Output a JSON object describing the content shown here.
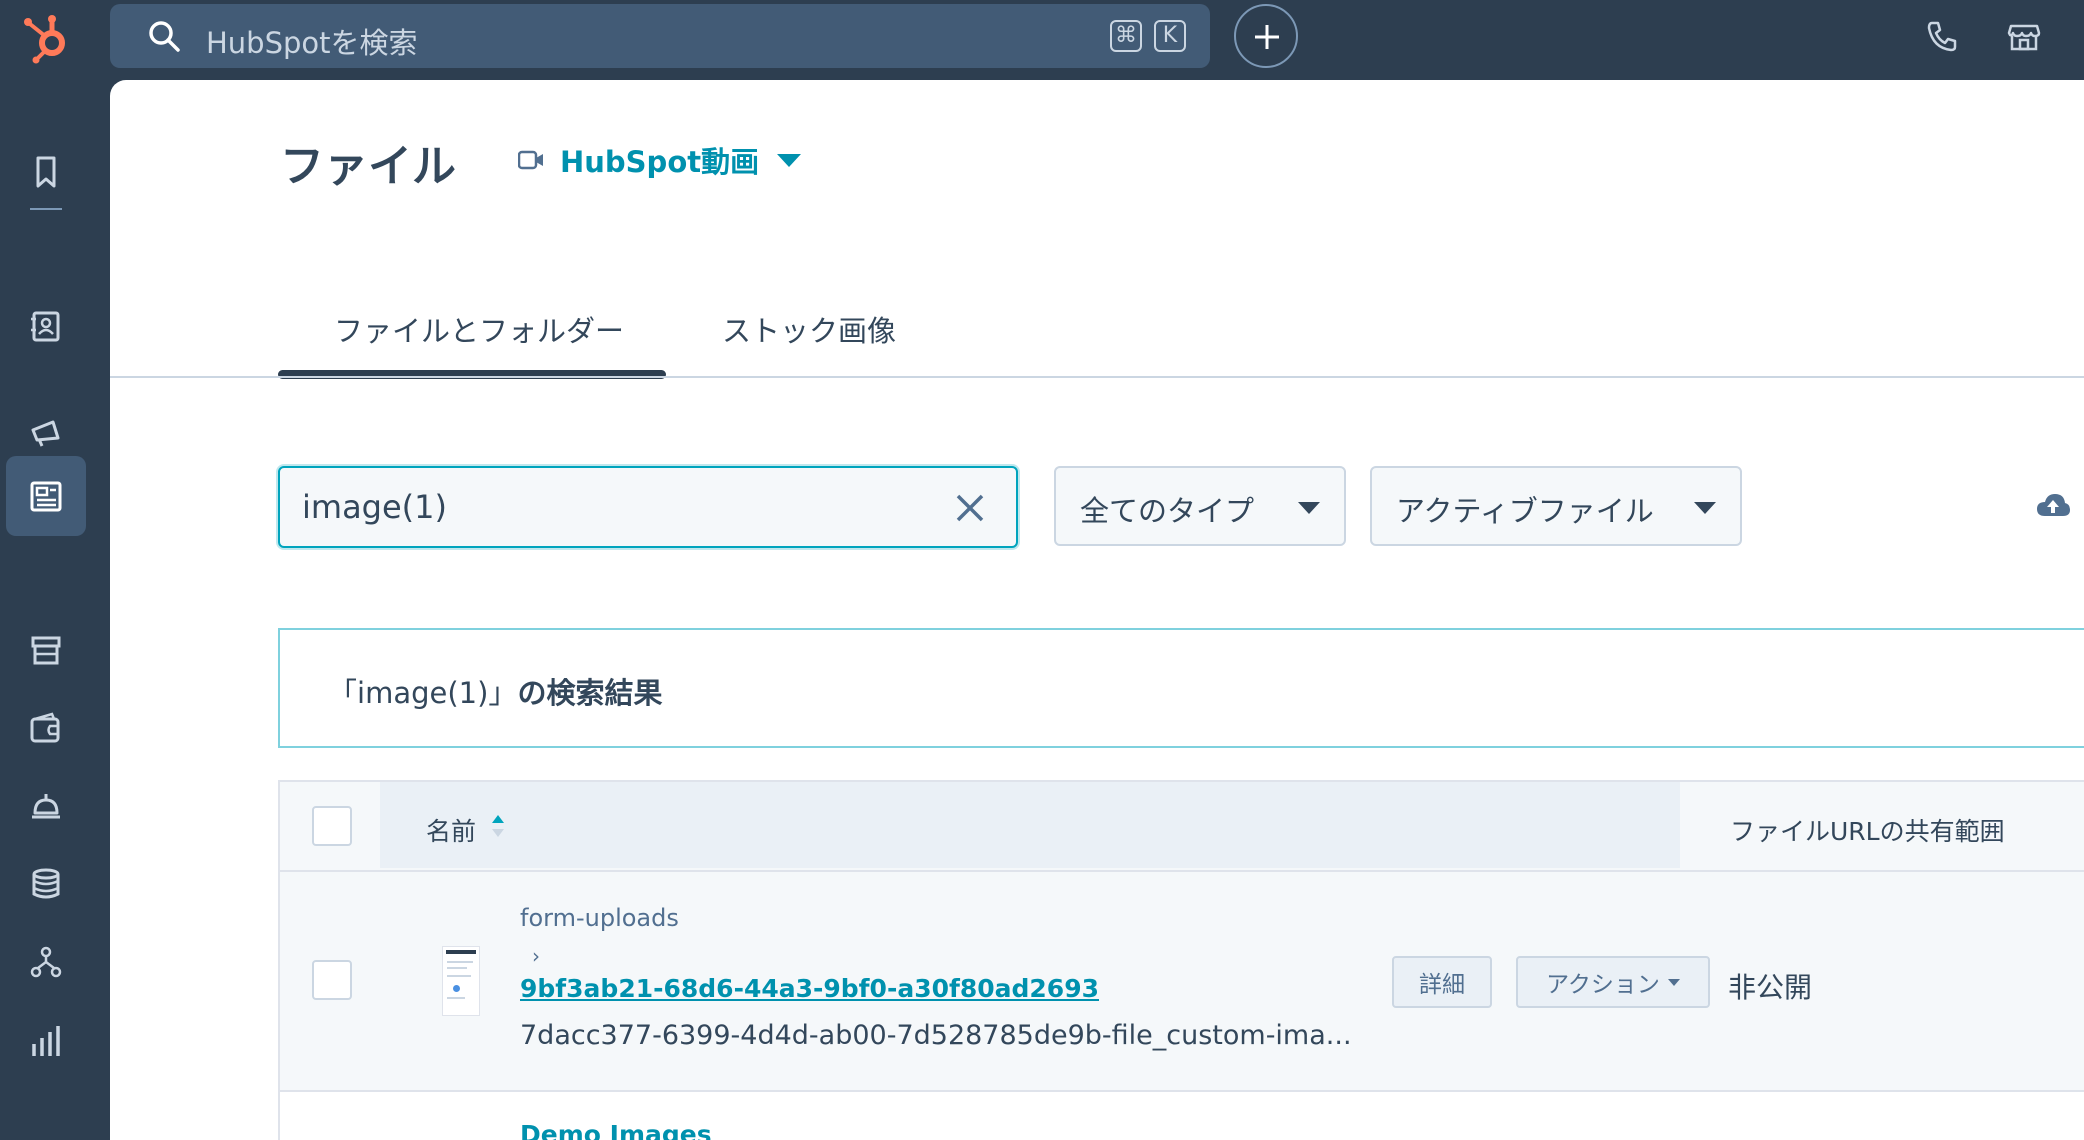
{
  "topbar": {
    "search_placeholder": "HubSpotを検索",
    "shortcut_key1": "⌘",
    "shortcut_key2": "K"
  },
  "page": {
    "title": "ファイル",
    "video_link": "HubSpot動画"
  },
  "tabs": [
    {
      "label": "ファイルとフォルダー",
      "active": true
    },
    {
      "label": "ストック画像",
      "active": false
    }
  ],
  "filters": {
    "search_value": "image(1)",
    "type_select": "全てのタイプ",
    "status_select": "アクティブファイル"
  },
  "results": {
    "quote_open": "「",
    "query": "image(1)",
    "quote_close": "」",
    "suffix": "の検索結果"
  },
  "table": {
    "columns": {
      "name": "名前",
      "visibility": "ファイルURLの共有範囲"
    },
    "rows": [
      {
        "folder": "form-uploads",
        "chevron": "›",
        "link": "9bf3ab21-68d6-44a3-9bf0-a30f80ad2693",
        "filename": "7dacc377-6399-4d4d-ab00-7d528785de9b-file_custom-ima...",
        "details_button": "詳細",
        "actions_button": "アクション",
        "visibility": "非公開"
      },
      {
        "folder": "Demo Images"
      }
    ]
  },
  "colors": {
    "nav_bg": "#2d3e50",
    "accent": "#0091ae",
    "focus": "#00a4bd",
    "logo": "#ff7a59"
  }
}
